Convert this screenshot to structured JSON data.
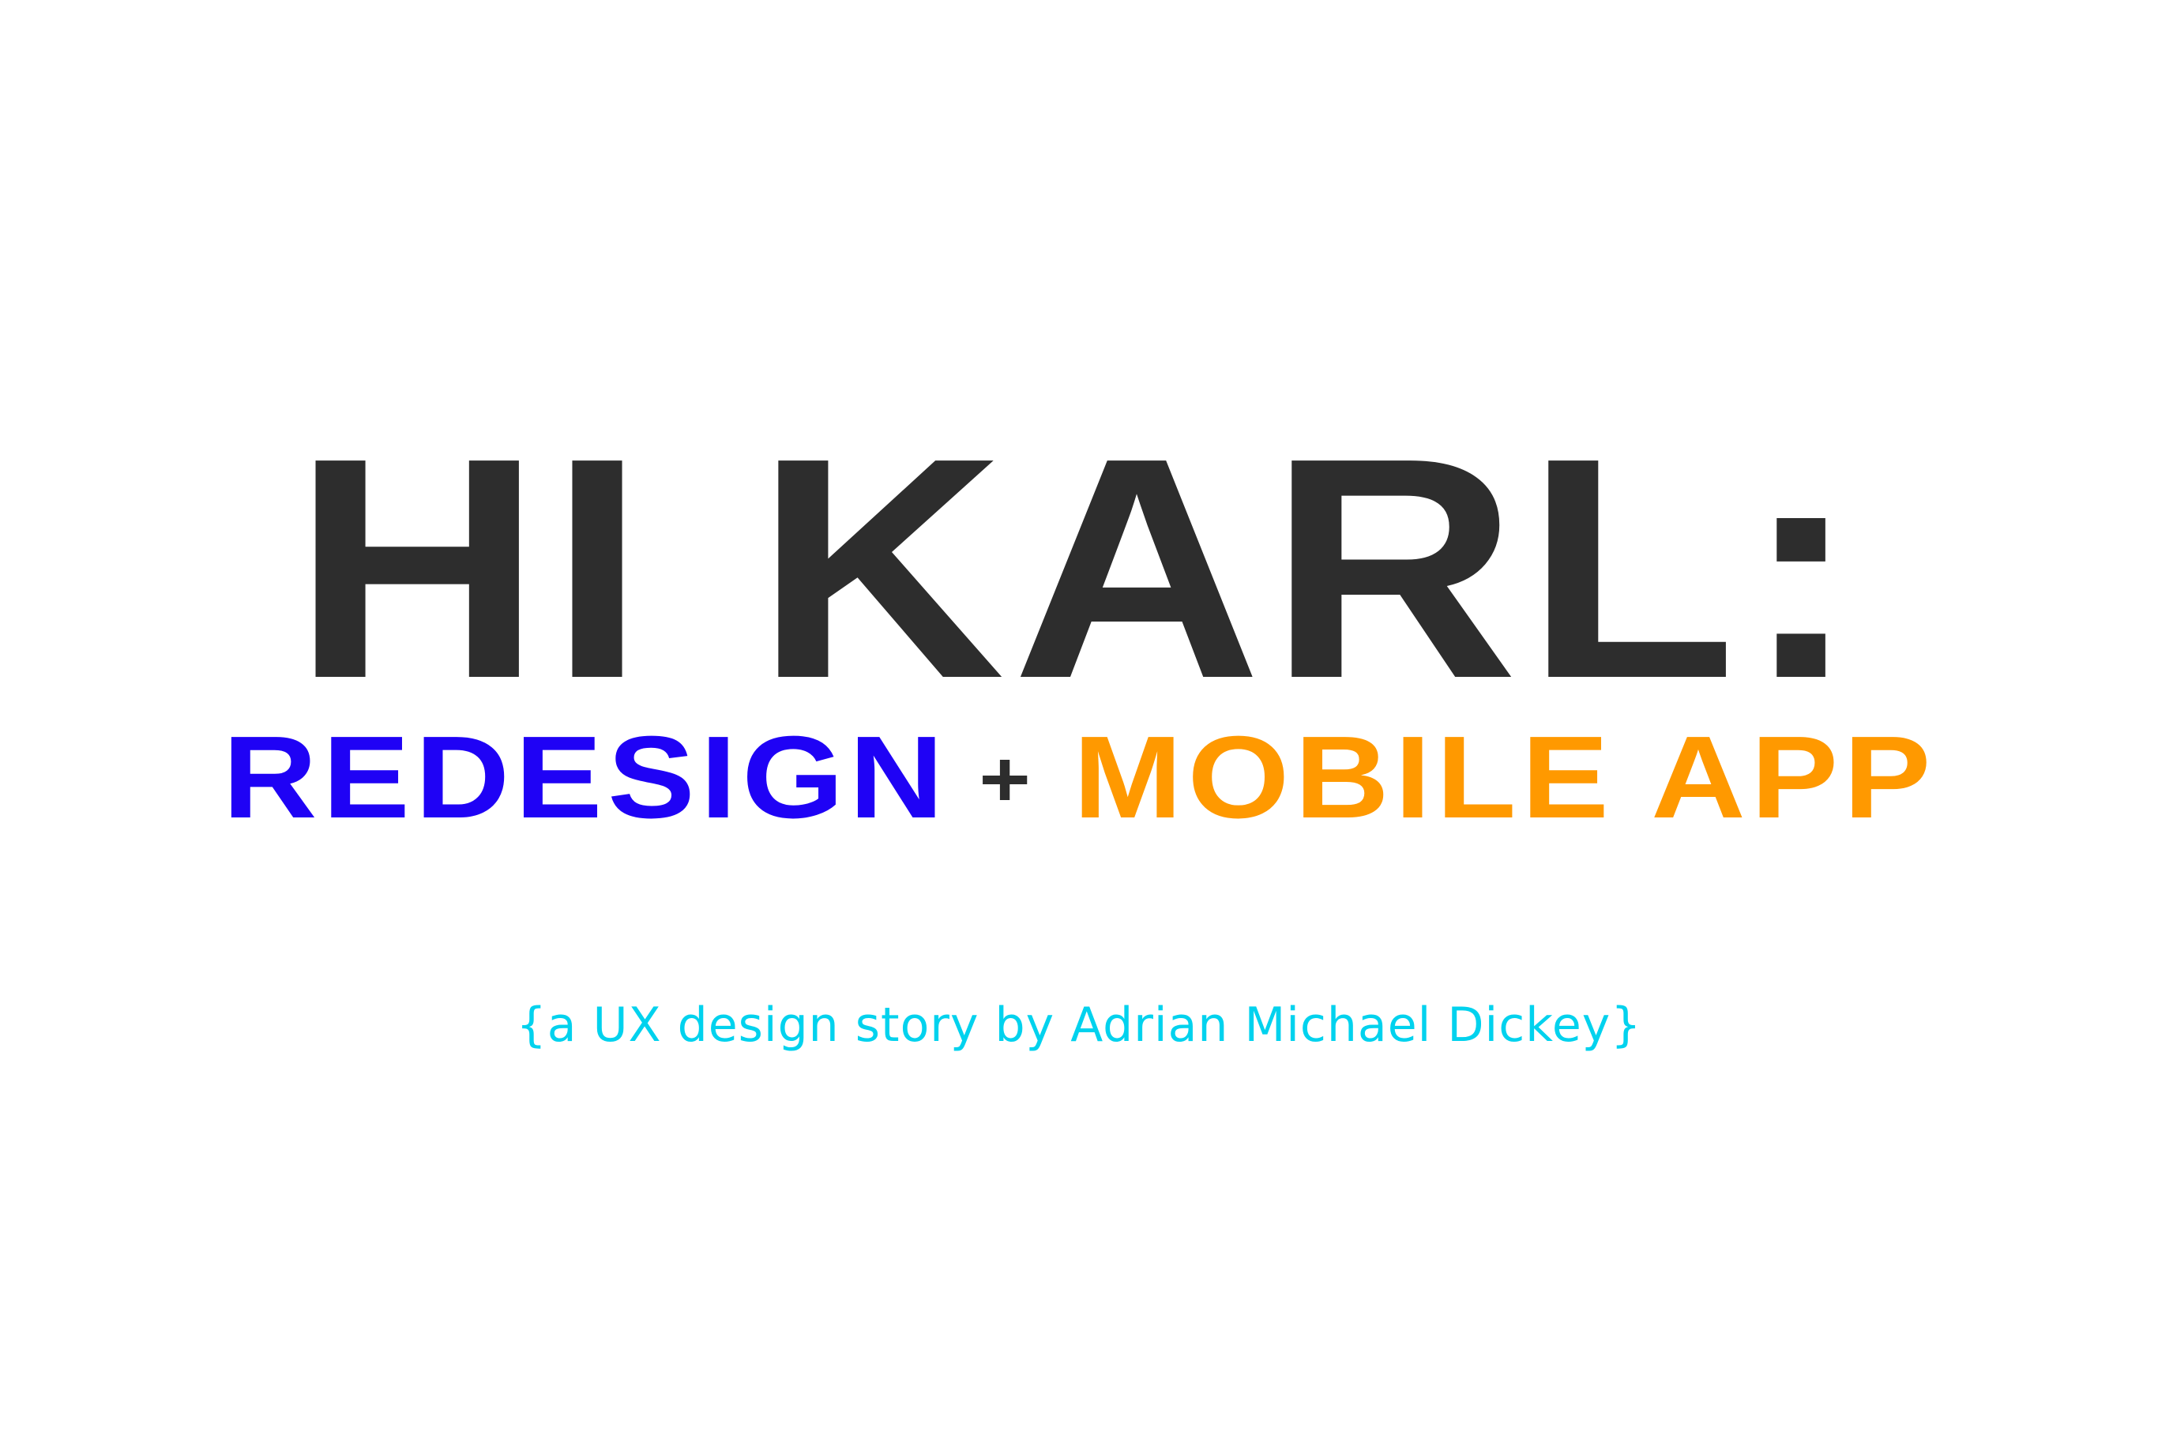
{
  "hero": {
    "title": "HI KARL:",
    "subtitle": {
      "part1": "REDESIGN",
      "separator": "+",
      "part2": "MOBILE APP"
    },
    "tagline": "{a UX design story by Adrian Michael Dickey}"
  },
  "colors": {
    "background": "#ffffff",
    "title": "#2d2d2d",
    "redesign": "#1f02f5",
    "mobile_app": "#ff9900",
    "tagline": "#00d2ee"
  }
}
